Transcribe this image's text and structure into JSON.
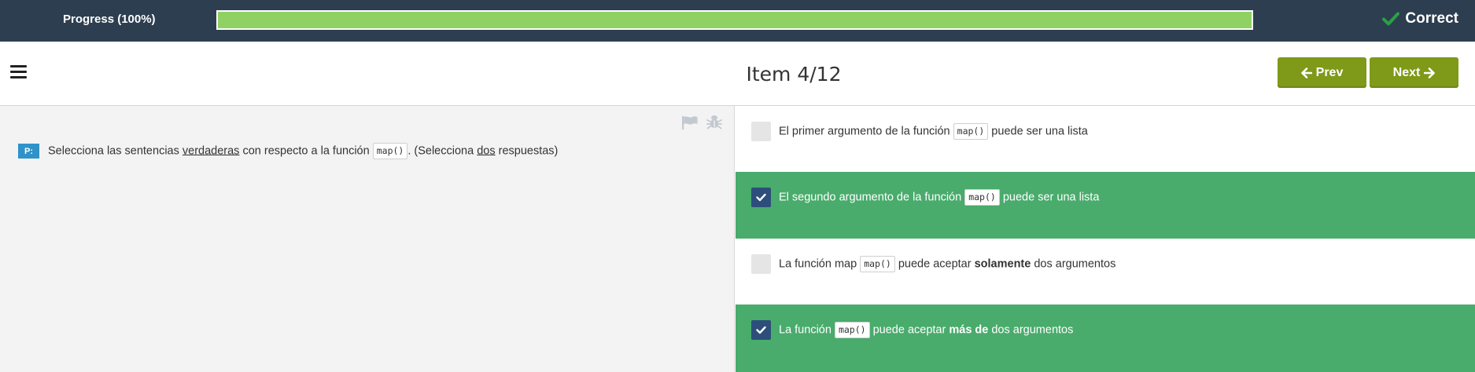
{
  "progress": {
    "label": "Progress (100%)",
    "percent": 100
  },
  "status": {
    "label": "Correct"
  },
  "header": {
    "item_title": "Item 4/12"
  },
  "nav": {
    "prev_label": "Prev",
    "next_label": "Next"
  },
  "question": {
    "badge": "P:",
    "part1": "Selecciona las sentencias ",
    "underline1": "verdaderas",
    "part2": " con respecto a la función ",
    "code": "map()",
    "part3": ". (Selecciona ",
    "underline2": "dos",
    "part4": " respuestas)"
  },
  "options": [
    {
      "selected": false,
      "t1": "El primer argumento de la función ",
      "code": "map()",
      "t2": " puede ser una lista",
      "bold": "",
      "t3": ""
    },
    {
      "selected": true,
      "t1": "El segundo argumento de la función ",
      "code": "map()",
      "t2": " puede ser una lista",
      "bold": "",
      "t3": ""
    },
    {
      "selected": false,
      "t1": "La función map ",
      "code": "map()",
      "t2": " puede aceptar ",
      "bold": "solamente",
      "t3": " dos argumentos"
    },
    {
      "selected": true,
      "t1": "La función ",
      "code": "map()",
      "t2": " puede aceptar ",
      "bold": "más de",
      "t3": " dos argumentos"
    }
  ],
  "colors": {
    "topbar": "#2d3e50",
    "progress_fill": "#8fd163",
    "nav_button": "#7e9a18",
    "selected_option": "#49ab6c",
    "checkbox_checked": "#2d4e7a",
    "badge": "#2f93c9"
  },
  "icons": [
    "check-icon",
    "menu-icon",
    "arrow-left-icon",
    "arrow-right-icon",
    "flag-icon",
    "bug-icon"
  ]
}
